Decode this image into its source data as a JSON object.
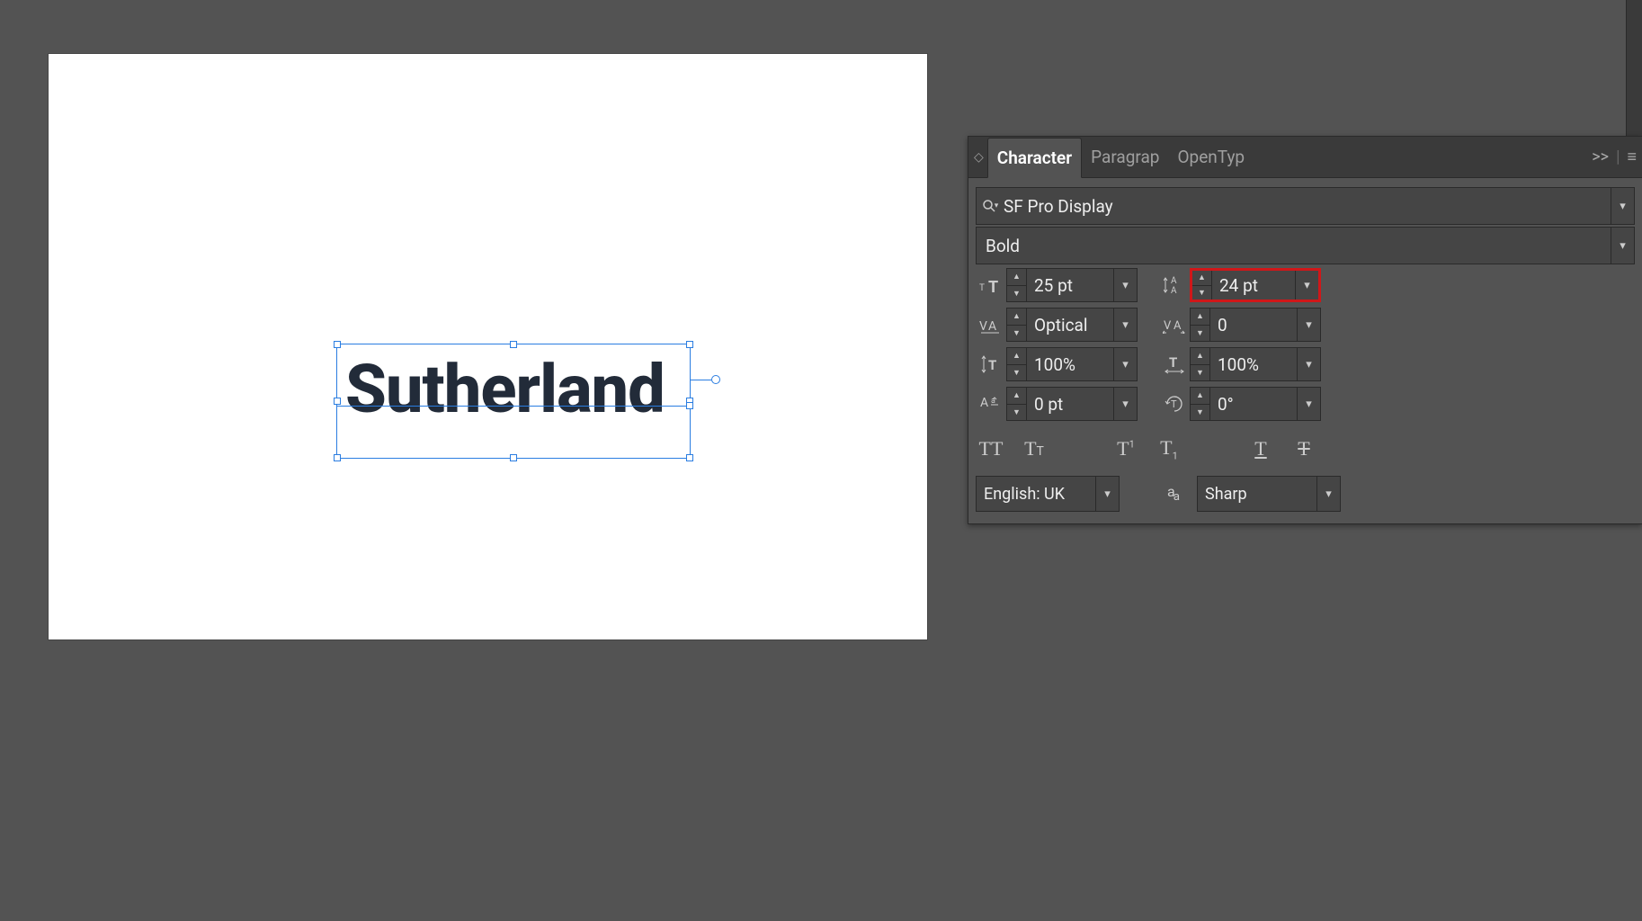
{
  "canvas": {
    "sample_text": "Sutherland"
  },
  "panel": {
    "tabs": {
      "character": "Character",
      "paragraph": "Paragrap",
      "opentype": "OpenTyp"
    },
    "font_family": "SF Pro Display",
    "font_style": "Bold",
    "font_size": "25 pt",
    "leading": "24 pt",
    "kerning": "Optical",
    "tracking": "0",
    "vscale": "100%",
    "hscale": "100%",
    "baseline_shift": "0 pt",
    "rotation": "0°",
    "language": "English: UK",
    "antialias": "Sharp"
  }
}
